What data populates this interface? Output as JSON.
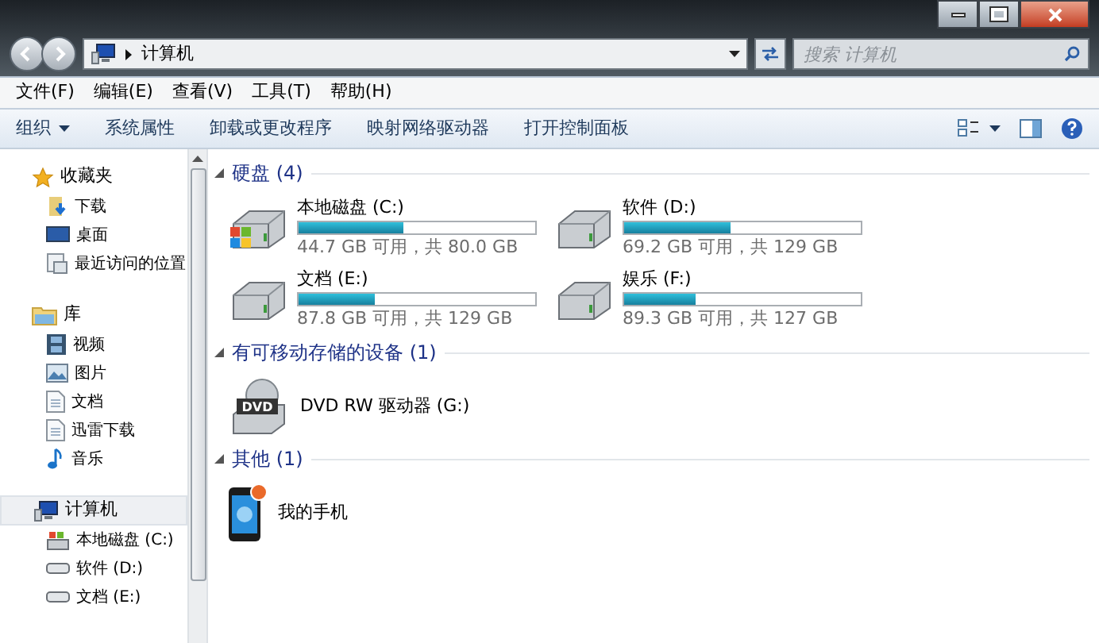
{
  "address": {
    "path": [
      "计算机"
    ]
  },
  "search": {
    "placeholder": "搜索 计算机"
  },
  "menu": [
    "文件(F)",
    "编辑(E)",
    "查看(V)",
    "工具(T)",
    "帮助(H)"
  ],
  "toolbar": [
    {
      "label": "组织",
      "dropdown": true
    },
    {
      "label": "系统属性",
      "dropdown": false
    },
    {
      "label": "卸载或更改程序",
      "dropdown": false
    },
    {
      "label": "映射网络驱动器",
      "dropdown": false
    },
    {
      "label": "打开控制面板",
      "dropdown": false
    }
  ],
  "sidebar": [
    {
      "label": "收藏夹",
      "kind": "star",
      "selected": false,
      "children": [
        {
          "label": "下载",
          "kind": "download"
        },
        {
          "label": "桌面",
          "kind": "desktop"
        },
        {
          "label": "最近访问的位置",
          "kind": "recent"
        }
      ]
    },
    {
      "label": "库",
      "kind": "library",
      "selected": false,
      "children": [
        {
          "label": "视频",
          "kind": "video"
        },
        {
          "label": "图片",
          "kind": "picture"
        },
        {
          "label": "文档",
          "kind": "document"
        },
        {
          "label": "迅雷下载",
          "kind": "document"
        },
        {
          "label": "音乐",
          "kind": "music"
        }
      ]
    },
    {
      "label": "计算机",
      "kind": "computer",
      "selected": true,
      "children": [
        {
          "label": "本地磁盘 (C:)",
          "kind": "system"
        },
        {
          "label": "软件 (D:)",
          "kind": "drive"
        },
        {
          "label": "文档 (E:)",
          "kind": "drive"
        }
      ]
    }
  ],
  "sections": [
    {
      "title": "硬盘 (4)",
      "items": [
        {
          "kind": "system_drive",
          "name": "本地磁盘 (C:)",
          "level": 0.44,
          "reading": "44.7 GB 可用，共 80.0 GB"
        },
        {
          "kind": "drive",
          "name": "软件 (D:)",
          "level": 0.45,
          "reading": "69.2 GB 可用，共 129 GB"
        },
        {
          "kind": "drive",
          "name": "文档 (E:)",
          "level": 0.32,
          "reading": "87.8 GB 可用，共 129 GB"
        },
        {
          "kind": "drive",
          "name": "娱乐 (F:)",
          "level": 0.3,
          "reading": "89.3 GB 可用，共 127 GB"
        }
      ]
    },
    {
      "title": "有可移动存储的设备 (1)",
      "items": [
        {
          "kind": "dvd",
          "name": "DVD RW 驱动器 (G:)",
          "badge": "DVD"
        }
      ]
    },
    {
      "title": "其他 (1)",
      "items": [
        {
          "kind": "phone",
          "name": "我的手机"
        }
      ]
    }
  ]
}
